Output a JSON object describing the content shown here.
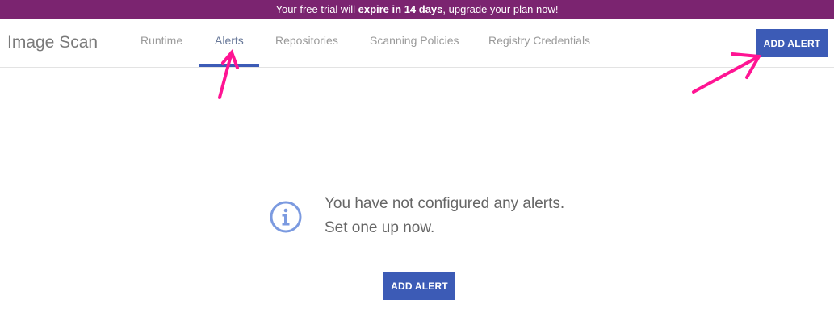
{
  "banner": {
    "prefix": "Your free trial will ",
    "highlight": "expire in 14 days",
    "suffix": ", upgrade your plan now!"
  },
  "header": {
    "title": "Image Scan",
    "tabs": [
      {
        "label": "Runtime",
        "active": false
      },
      {
        "label": "Alerts",
        "active": true
      },
      {
        "label": "Repositories",
        "active": false
      },
      {
        "label": "Scanning Policies",
        "active": false
      },
      {
        "label": "Registry Credentials",
        "active": false
      }
    ],
    "add_alert_label": "ADD ALERT"
  },
  "empty_state": {
    "icon": "info-icon",
    "line1": "You have not configured any alerts.",
    "line2": "Set one up now.",
    "button_label": "ADD ALERT"
  },
  "colors": {
    "banner_bg": "#7b2470",
    "accent": "#3c5bb6",
    "annotation_arrow": "#ff1493"
  }
}
